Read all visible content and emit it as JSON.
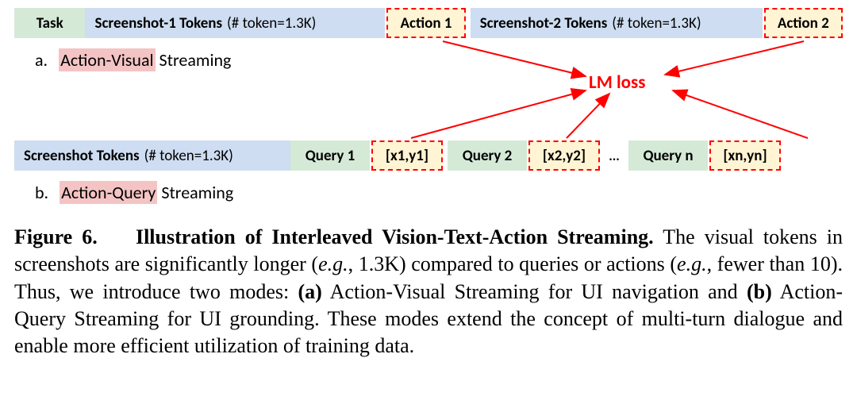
{
  "rowA": {
    "task": "Task",
    "screenshot1": "Screenshot-1 Tokens",
    "tokenCount1": "(# token=1.3K)",
    "action1": "Action 1",
    "screenshot2": "Screenshot-2 Tokens",
    "tokenCount2": "(# token=1.3K)",
    "action2": "Action 2"
  },
  "labelA": {
    "letter": "a.",
    "highlighted": "Action-Visual",
    "rest": " Streaming"
  },
  "lmLoss": "LM loss",
  "rowB": {
    "screenshot": "Screenshot Tokens",
    "tokenCount": "(# token=1.3K)",
    "query1": "Query 1",
    "xy1": "[x1,y1]",
    "query2": "Query 2",
    "xy2": "[x2,y2]",
    "dots": "...",
    "queryN": "Query n",
    "xyN": "[xn,yn]"
  },
  "labelB": {
    "letter": "b.",
    "highlighted": "Action-Query",
    "rest": " Streaming"
  },
  "caption": {
    "figNum": "Figure 6.",
    "title": "Illustration of Interleaved Vision-Text-Action Streaming.",
    "body1": "The visual tokens in screenshots are significantly longer (",
    "eg1": "e.g.",
    "body2": ", 1.3K) compared to queries or actions (",
    "eg2": "e.g.",
    "body3": ", fewer than 10). Thus, we introduce two modes: ",
    "boldA": "(a)",
    "body4": " Action-Visual Streaming for UI navigation and ",
    "boldB": "(b)",
    "body5": " Action-Query Streaming for UI grounding. These modes extend the concept of multi-turn dialogue and enable more efficient utilization of training data."
  }
}
